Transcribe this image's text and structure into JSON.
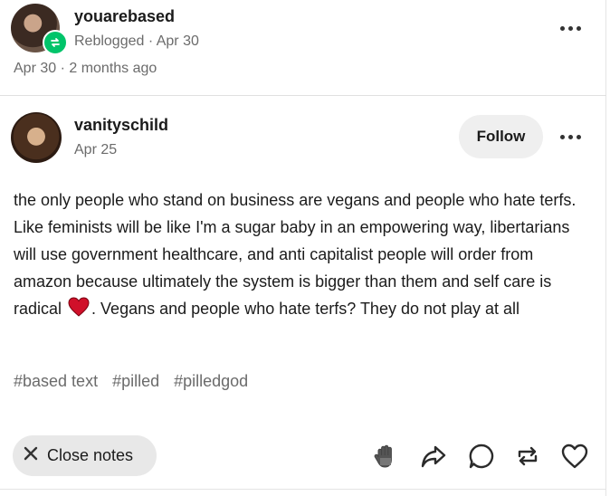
{
  "reblogger": {
    "username": "youarebased",
    "subline": "Reblogged · Apr 30",
    "dateline": "Apr 30 · 2 months ago"
  },
  "post": {
    "username": "vanityschild",
    "date": "Apr 25",
    "follow_label": "Follow",
    "body_part1": "the only people who stand on business are vegans and people who hate terfs. Like feminists will be like I'm a sugar baby in an empowering way, libertarians will use government healthcare, and anti capitalist people will order from amazon because ultimately the system is bigger than them and self care is radical",
    "body_part2": ". Vegans and people who hate terfs? They do not play at all",
    "tags": [
      "#based text",
      "#pilled",
      "#pilledgod"
    ]
  },
  "footer": {
    "close_notes_label": "Close notes",
    "icons": [
      "hand-icon",
      "share-icon",
      "reply-icon",
      "reblog-icon",
      "like-icon"
    ]
  },
  "colors": {
    "reblog_badge": "#00c46a",
    "heart": "#d0102a",
    "muted_text": "#6b6b6b",
    "button_bg": "#efefef"
  }
}
